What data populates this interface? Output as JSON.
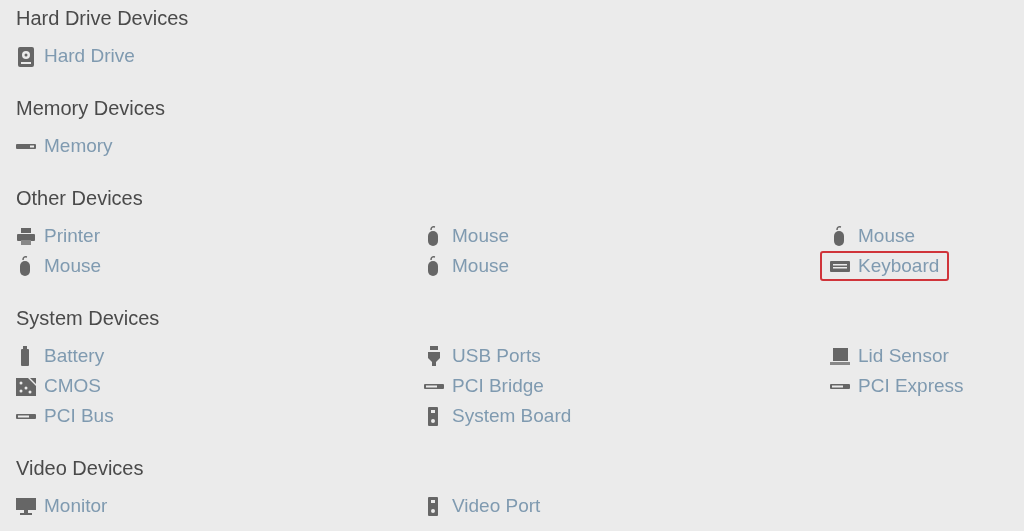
{
  "sections": [
    {
      "title": "Hard Drive Devices",
      "items": [
        {
          "label": "Hard Drive",
          "kind": "hard-drive",
          "highlighted": false
        }
      ]
    },
    {
      "title": "Memory Devices",
      "items": [
        {
          "label": "Memory",
          "kind": "memory",
          "highlighted": false
        }
      ]
    },
    {
      "title": "Other Devices",
      "items": [
        {
          "label": "Printer",
          "kind": "printer",
          "highlighted": false
        },
        {
          "label": "Mouse",
          "kind": "mouse",
          "highlighted": false
        },
        {
          "label": "Mouse",
          "kind": "mouse",
          "highlighted": false
        },
        {
          "label": "Mouse",
          "kind": "mouse",
          "highlighted": false
        },
        {
          "label": "Mouse",
          "kind": "mouse",
          "highlighted": false
        },
        {
          "label": "Keyboard",
          "kind": "keyboard",
          "highlighted": true
        }
      ]
    },
    {
      "title": "System Devices",
      "items": [
        {
          "label": "Battery",
          "kind": "battery",
          "highlighted": false
        },
        {
          "label": "USB Ports",
          "kind": "usb",
          "highlighted": false
        },
        {
          "label": "Lid Sensor",
          "kind": "laptop",
          "highlighted": false
        },
        {
          "label": "CMOS",
          "kind": "chip",
          "highlighted": false
        },
        {
          "label": "PCI Bridge",
          "kind": "slot",
          "highlighted": false
        },
        {
          "label": "PCI Express",
          "kind": "slot",
          "highlighted": false
        },
        {
          "label": "PCI Bus",
          "kind": "slot",
          "highlighted": false
        },
        {
          "label": "System Board",
          "kind": "tower",
          "highlighted": false
        }
      ]
    },
    {
      "title": "Video Devices",
      "items": [
        {
          "label": "Monitor",
          "kind": "monitor",
          "highlighted": false
        },
        {
          "label": "Video Port",
          "kind": "tower",
          "highlighted": false
        }
      ]
    }
  ]
}
